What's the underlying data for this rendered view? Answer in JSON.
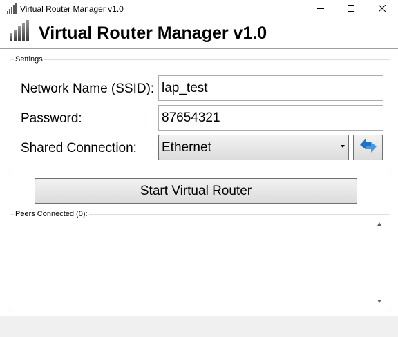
{
  "window": {
    "title": "Virtual Router Manager v1.0",
    "app_icon": "signal-bars-icon",
    "minimize_icon": "minimize-icon",
    "maximize_icon": "maximize-icon",
    "close_icon": "close-icon"
  },
  "header": {
    "title": "Virtual Router Manager v1.0",
    "icon": "signal-bars-icon"
  },
  "settings": {
    "group_label": "Settings",
    "ssid_label": "Network Name (SSID):",
    "ssid_value": "lap_test",
    "password_label": "Password:",
    "password_value": "87654321",
    "shared_label": "Shared Connection:",
    "shared_value": "Ethernet",
    "refresh_icon": "refresh-arrows-icon"
  },
  "actions": {
    "start_label": "Start Virtual Router"
  },
  "peers": {
    "group_label": "Peers Connected (0):",
    "count": 0,
    "items": []
  },
  "colors": {
    "accent_blue": "#1e73c8",
    "button_gradient_top": "#f2f2f2",
    "button_gradient_bottom": "#dcdcdc",
    "border": "#707070"
  }
}
